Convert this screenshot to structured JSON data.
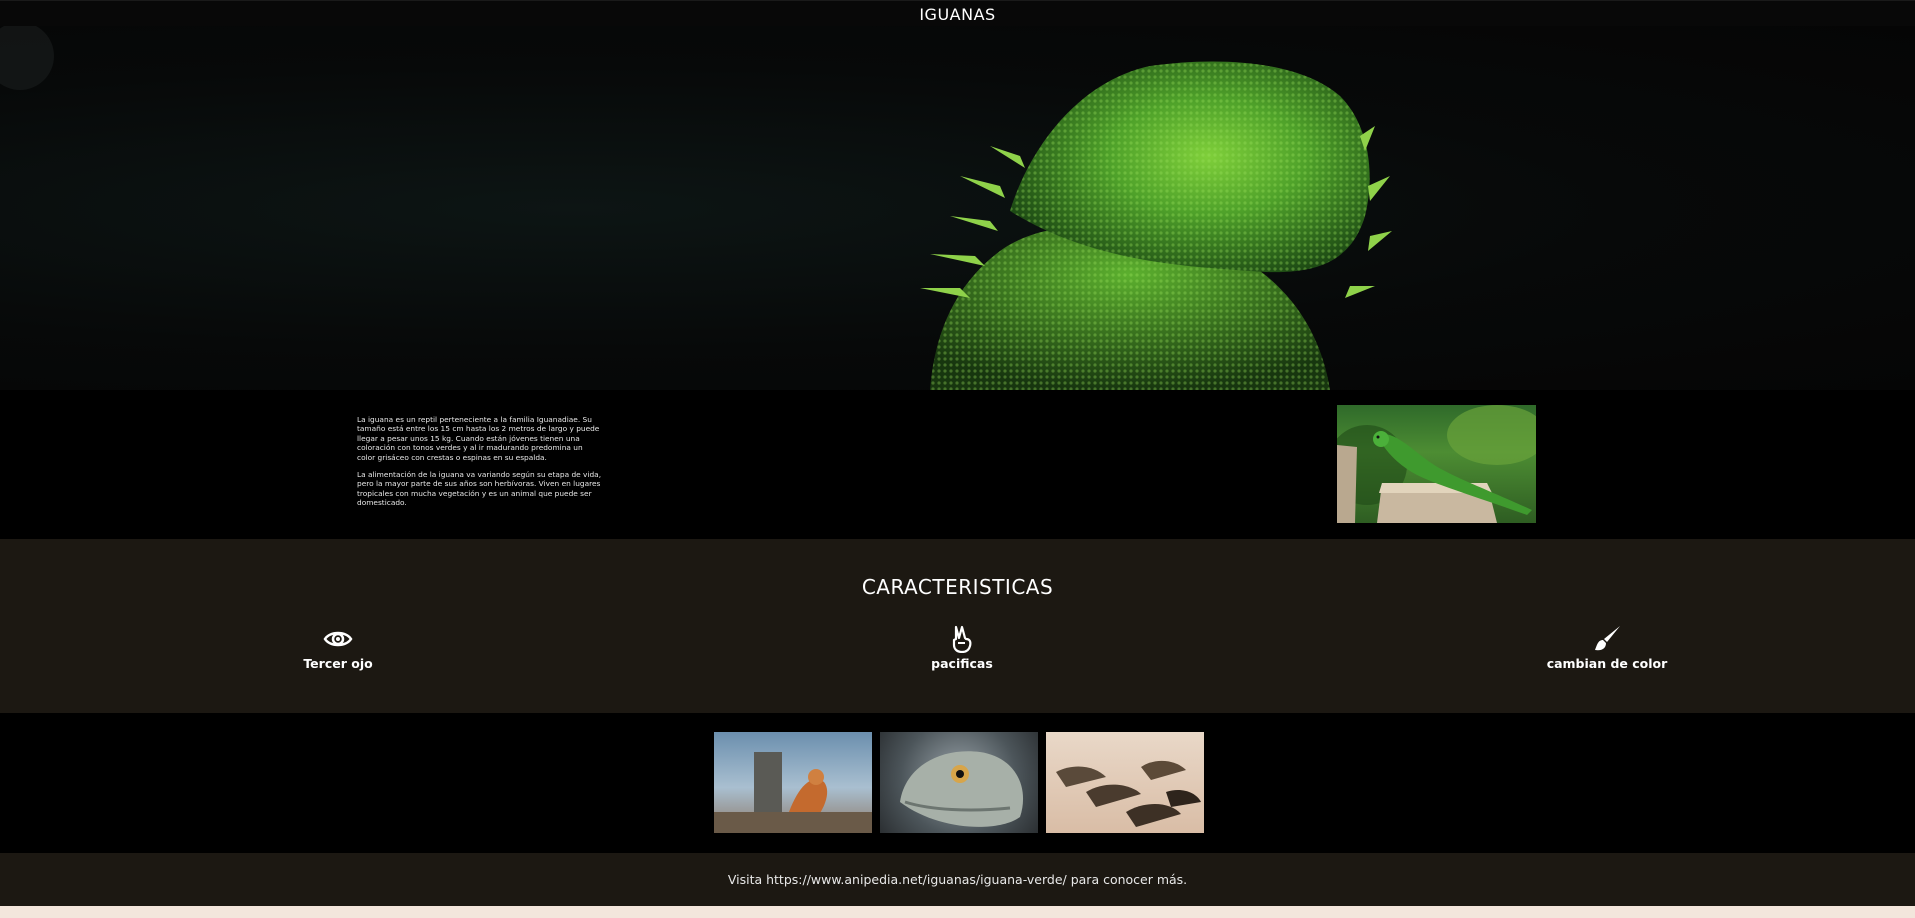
{
  "header": {
    "title": "IGUANAS"
  },
  "intro": {
    "paragraphs": [
      "La iguana es un reptil perteneciente a la familia Iguanadiae. Su tamaño está entre los 15 cm hasta los 2 metros de largo y puede llegar a pesar unos 15 kg. Cuando están jóvenes tienen una coloración con tonos verdes y al ir madurando predomina un color grisáceo con crestas o espinas en su espalda.",
      "La alimentación de la iguana va variando según su etapa de vida, pero la mayor parte de sus años son herbívoras. Viven en lugares tropicales con mucha vegetación y es un animal que puede ser domesticado."
    ]
  },
  "features": {
    "title": "CARACTERISTICAS",
    "items": [
      {
        "label": "Tercer ojo",
        "icon": "eye-icon"
      },
      {
        "label": "pacificas",
        "icon": "peace-hand-icon"
      },
      {
        "label": "cambian de color",
        "icon": "paint-brush-icon"
      }
    ]
  },
  "footer": {
    "text": "Visita https://www.anipedia.net/iguanas/iguana-verde/ para conocer más."
  },
  "colors": {
    "page_background": "#f3e6dc",
    "section_dark": "#000000",
    "section_brown": "#1c1812",
    "text": "#ffffff"
  }
}
